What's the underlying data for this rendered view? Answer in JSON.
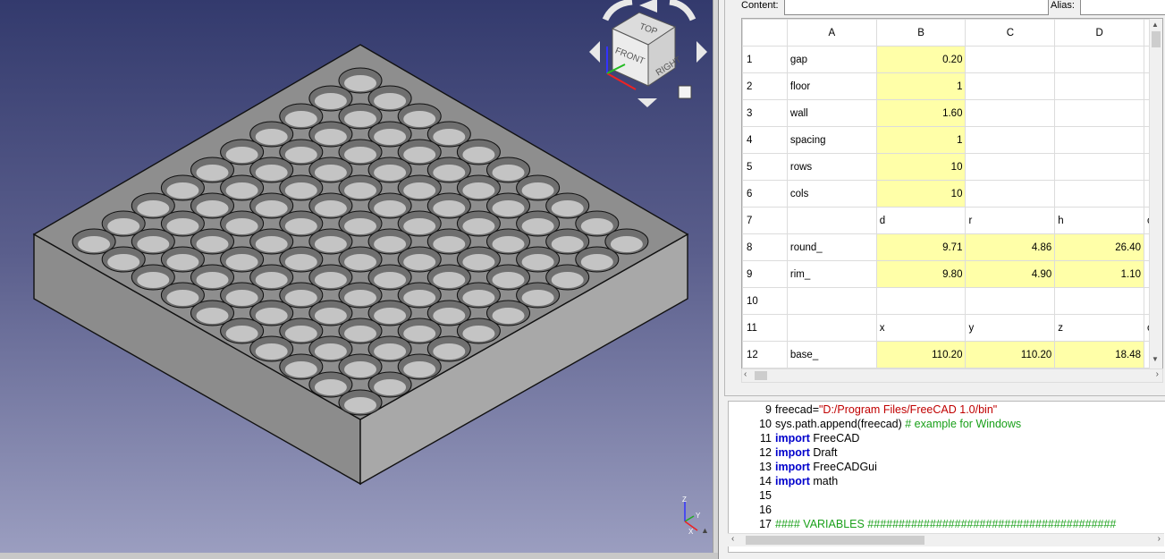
{
  "viewport": {
    "background_top": "#333a6d",
    "background_bottom": "#9c9fc1",
    "navcube": {
      "top_label": "TOP",
      "front_label": "FRONT",
      "right_label": "RIGHT"
    },
    "axis": {
      "z": "Z",
      "y": "Y",
      "x": "X"
    }
  },
  "sheet": {
    "content_label": "Content:",
    "alias_label": "Alias:",
    "content_value": "",
    "alias_value": "",
    "columns": [
      "A",
      "B",
      "C",
      "D"
    ],
    "rows": [
      {
        "n": "1",
        "cells": [
          "gap",
          "0.20",
          "",
          ""
        ],
        "yellow": [
          false,
          true,
          false,
          false
        ]
      },
      {
        "n": "2",
        "cells": [
          "floor",
          "1",
          "",
          ""
        ],
        "yellow": [
          false,
          true,
          false,
          false
        ]
      },
      {
        "n": "3",
        "cells": [
          "wall",
          "1.60",
          "",
          ""
        ],
        "yellow": [
          false,
          true,
          false,
          false
        ]
      },
      {
        "n": "4",
        "cells": [
          "spacing",
          "1",
          "",
          ""
        ],
        "yellow": [
          false,
          true,
          false,
          false
        ]
      },
      {
        "n": "5",
        "cells": [
          "rows",
          "10",
          "",
          ""
        ],
        "yellow": [
          false,
          true,
          false,
          false
        ]
      },
      {
        "n": "6",
        "cells": [
          "cols",
          "10",
          "",
          ""
        ],
        "yellow": [
          false,
          true,
          false,
          false
        ]
      },
      {
        "n": "7",
        "cells": [
          "",
          "d",
          "r",
          "h"
        ],
        "yellow": [
          false,
          false,
          false,
          false
        ]
      },
      {
        "n": "8",
        "cells": [
          "round_",
          "9.71",
          "4.86",
          "26.40"
        ],
        "yellow": [
          false,
          true,
          true,
          true
        ]
      },
      {
        "n": "9",
        "cells": [
          "rim_",
          "9.80",
          "4.90",
          "1.10"
        ],
        "yellow": [
          false,
          true,
          true,
          true
        ]
      },
      {
        "n": "10",
        "cells": [
          "",
          "",
          "",
          ""
        ],
        "yellow": [
          false,
          false,
          false,
          false
        ]
      },
      {
        "n": "11",
        "cells": [
          "",
          "x",
          "y",
          "z"
        ],
        "yellow": [
          false,
          false,
          false,
          false
        ]
      },
      {
        "n": "12",
        "cells": [
          "base_",
          "110.20",
          "110.20",
          "18.48"
        ],
        "yellow": [
          false,
          true,
          true,
          true
        ]
      }
    ],
    "cut_col_text": {
      "7": "c",
      "11": "c"
    },
    "yellow_color": "#ffffa8"
  },
  "console": {
    "lines": [
      {
        "n": "9",
        "parts": [
          [
            "plain",
            "freecad="
          ],
          [
            "str",
            "\"D:/Program Files/FreeCAD 1.0/bin\""
          ]
        ]
      },
      {
        "n": "10",
        "parts": [
          [
            "plain",
            "sys.path.append(freecad) "
          ],
          [
            "cm",
            "# example for Windows"
          ]
        ]
      },
      {
        "n": "11",
        "parts": [
          [
            "kw",
            "import"
          ],
          [
            "plain",
            " FreeCAD"
          ]
        ]
      },
      {
        "n": "12",
        "parts": [
          [
            "kw",
            "import"
          ],
          [
            "plain",
            " Draft"
          ]
        ]
      },
      {
        "n": "13",
        "parts": [
          [
            "kw",
            "import"
          ],
          [
            "plain",
            " FreeCADGui"
          ]
        ]
      },
      {
        "n": "14",
        "parts": [
          [
            "kw",
            "import"
          ],
          [
            "plain",
            " math"
          ]
        ]
      },
      {
        "n": "15",
        "parts": []
      },
      {
        "n": "16",
        "parts": []
      },
      {
        "n": "17",
        "parts": [
          [
            "cm",
            "#### VARIABLES ########################################"
          ]
        ]
      }
    ]
  }
}
